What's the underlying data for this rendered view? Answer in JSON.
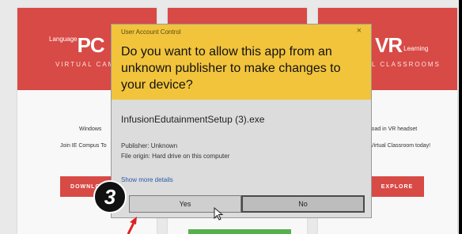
{
  "background_page": {
    "cards": [
      {
        "title_small": "Language",
        "title_big": "PC",
        "subtitle": "VIRTUAL CAM",
        "line1": "Windows",
        "line2": "Join IE Compus To",
        "button": "DOWNLOA"
      },
      {
        "title_small": "",
        "title_big": "",
        "subtitle": "",
        "line1": "",
        "line2": "",
        "button": ""
      },
      {
        "title_small": "Learning",
        "title_big": "VR",
        "subtitle": "L CLASSROOMS",
        "line1": "load in VR headset",
        "line2": "Virtual Classroom today!",
        "button": "EXPLORE"
      }
    ]
  },
  "uac_dialog": {
    "caption": "User Account Control",
    "close_glyph": "×",
    "question": "Do you want to allow this app from an unknown publisher to make changes to your device?",
    "filename": "InfusionEdutainmentSetup (3).exe",
    "publisher": "Publisher: Unknown",
    "origin": "File origin: Hard drive on this computer",
    "more_details": "Show more details",
    "yes_label": "Yes",
    "no_label": "No"
  },
  "overlay": {
    "step_number": "3"
  },
  "colors": {
    "uac_header": "#f2c43c",
    "card_red": "#d84a45",
    "link_blue": "#2d59a8",
    "cta_green": "#56b04b"
  }
}
